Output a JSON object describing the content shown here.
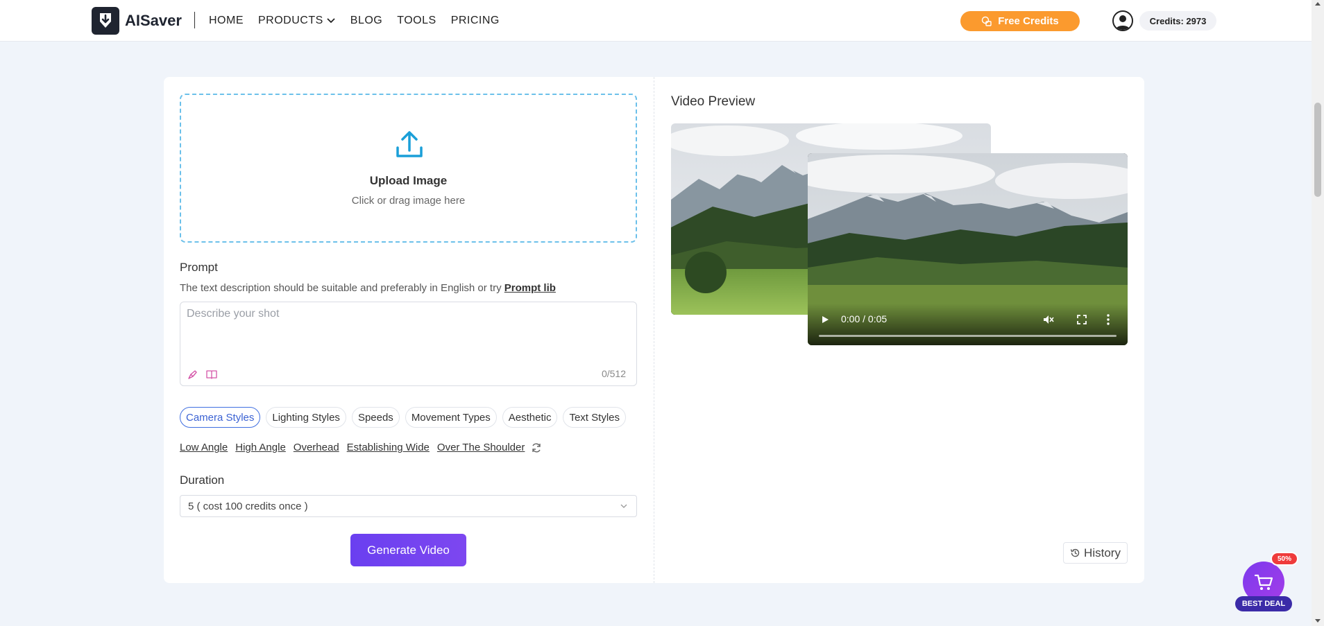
{
  "header": {
    "brand": "AISaver",
    "nav": [
      {
        "label": "HOME"
      },
      {
        "label": "PRODUCTS"
      },
      {
        "label": "BLOG"
      },
      {
        "label": "TOOLS"
      },
      {
        "label": "PRICING"
      }
    ],
    "free_credits_label": "Free Credits",
    "credits_label": "Credits: 2973"
  },
  "upload": {
    "title": "Upload Image",
    "subtitle": "Click or drag image here"
  },
  "prompt": {
    "label": "Prompt",
    "description": "The text description should be suitable and preferably in English or try",
    "lib_link": "Prompt lib",
    "placeholder": "Describe your shot",
    "counter": "0/512"
  },
  "style_tabs": [
    "Camera Styles",
    "Lighting Styles",
    "Speeds",
    "Movement Types",
    "Aesthetic",
    "Text Styles"
  ],
  "active_tab": "Camera Styles",
  "presets": [
    "Low Angle",
    "High Angle",
    "Overhead",
    "Establishing Wide",
    "Over The Shoulder"
  ],
  "duration": {
    "label": "Duration",
    "selected": "5 ( cost 100 credits once )"
  },
  "generate_label": "Generate Video",
  "preview": {
    "title": "Video Preview",
    "video_time": "0:00 / 0:05"
  },
  "history_label": "History",
  "deal": {
    "badge": "50%",
    "label": "BEST DEAL"
  },
  "colors": {
    "accent": "#6a3df0",
    "free_credits": "#fb9a2e",
    "upload_border": "#6cc0ea",
    "active_tab": "#3b62d3"
  }
}
